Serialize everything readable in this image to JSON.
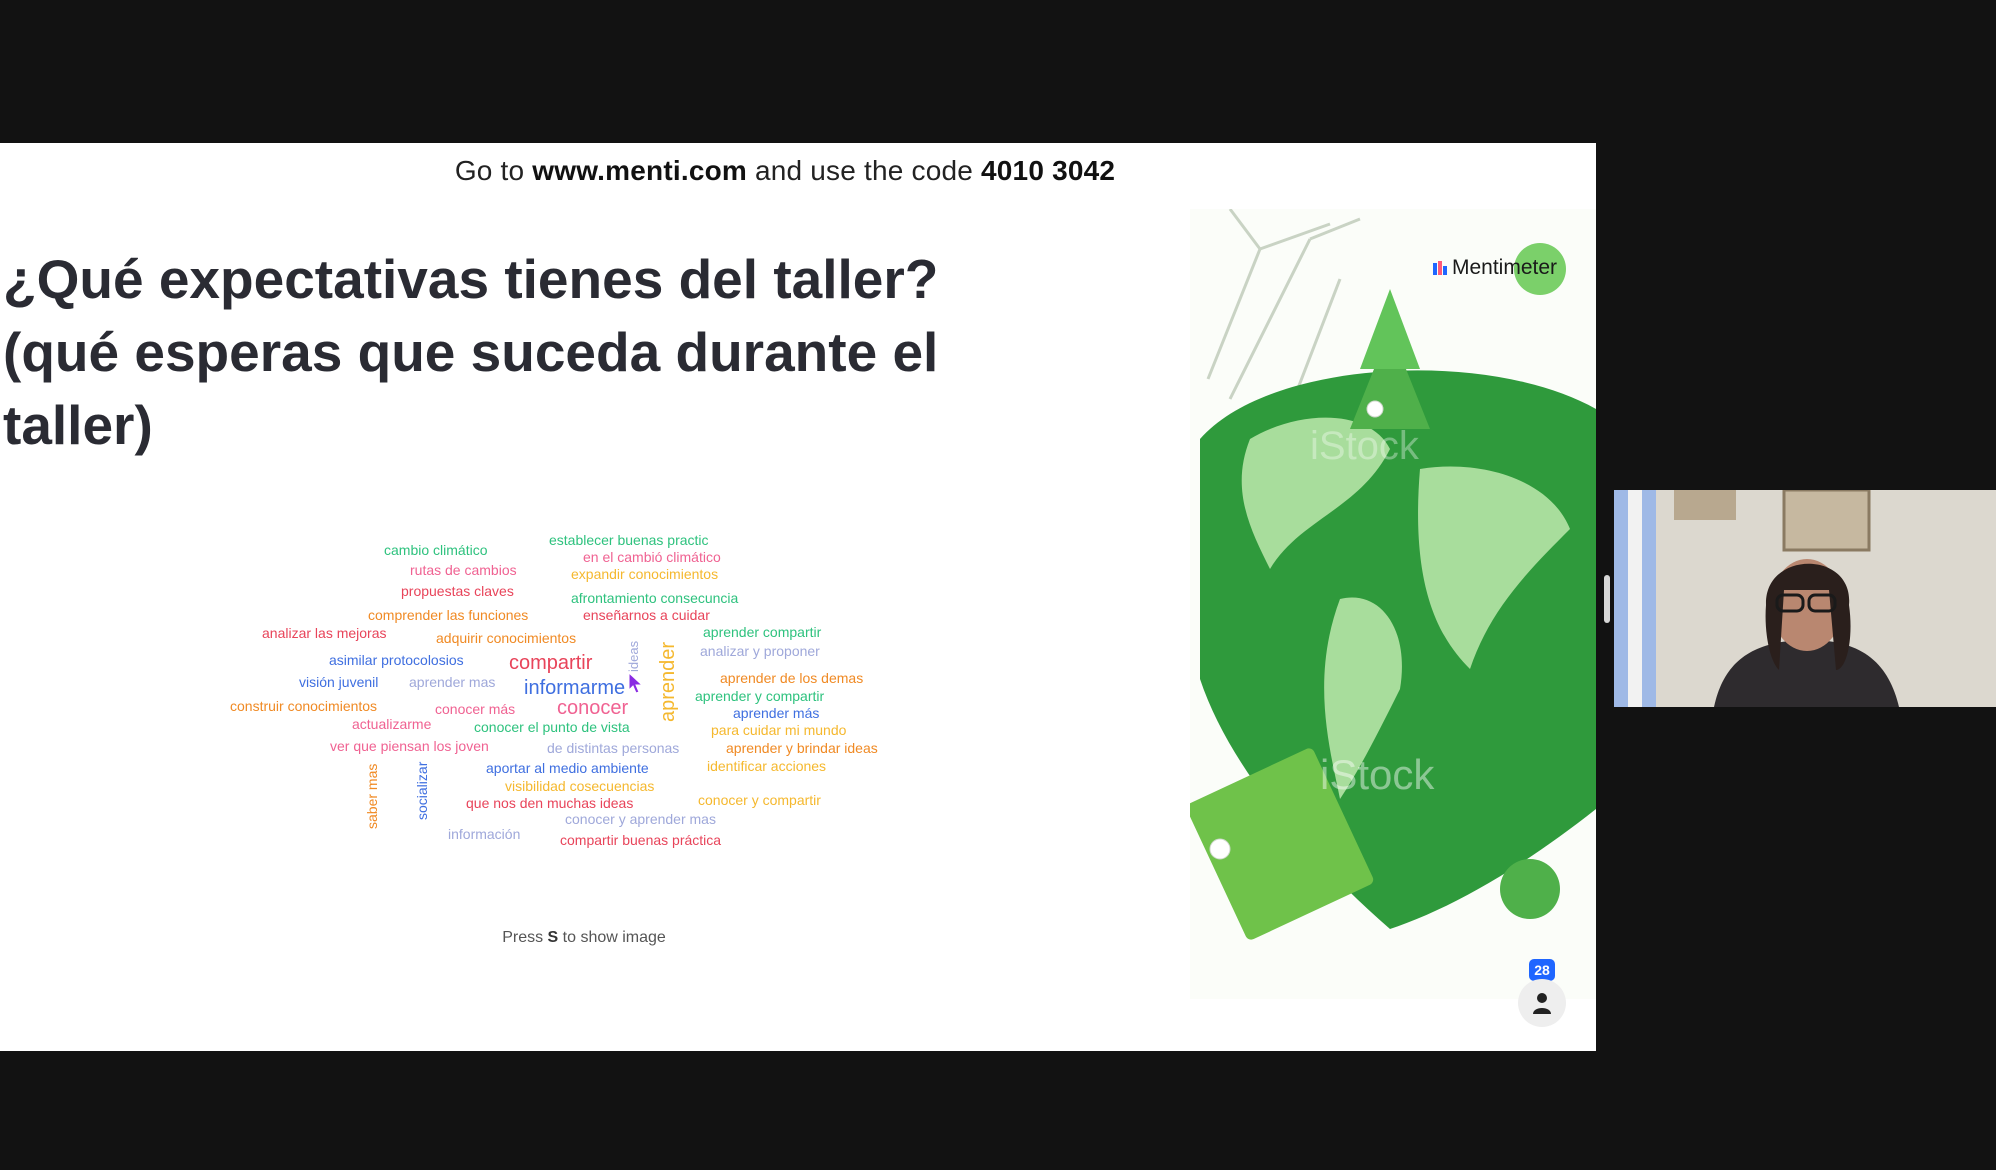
{
  "banner": {
    "prefix": "Go to ",
    "url": "www.menti.com",
    "middle": " and use the code ",
    "code": "4010 3042"
  },
  "question": {
    "line1": "¿Qué expectativas tienes del taller?",
    "line2": "(qué esperas que suceda durante el",
    "line3": "taller)"
  },
  "word_cloud": [
    {
      "text": "establecer buenas practic",
      "color": "#2ec27e"
    },
    {
      "text": "cambio climático",
      "color": "#2ec27e"
    },
    {
      "text": "en el cambió climático",
      "color": "#f06292"
    },
    {
      "text": "rutas de cambios",
      "color": "#f06292"
    },
    {
      "text": "expandir conocimientos",
      "color": "#f5b82e"
    },
    {
      "text": "propuestas claves",
      "color": "#e8445a"
    },
    {
      "text": "afrontamiento consecuncia",
      "color": "#2ec27e"
    },
    {
      "text": "comprender las funciones",
      "color": "#f08a24"
    },
    {
      "text": "enseñarnos a cuidar",
      "color": "#e8445a"
    },
    {
      "text": "analizar las mejoras",
      "color": "#e8445a"
    },
    {
      "text": "adquirir conocimientos",
      "color": "#f08a24"
    },
    {
      "text": "aprender compartir",
      "color": "#2ec27e"
    },
    {
      "text": "analizar y proponer",
      "color": "#9fa8da"
    },
    {
      "text": "asimilar protocolosios",
      "color": "#3f6fe0"
    },
    {
      "text": "compartir",
      "color": "#e8445a"
    },
    {
      "text": "ideas",
      "color": "#9fa8da"
    },
    {
      "text": "aprender",
      "color": "#f5b82e"
    },
    {
      "text": "aprender de los demas",
      "color": "#f08a24"
    },
    {
      "text": "visión juvenil",
      "color": "#3f6fe0"
    },
    {
      "text": "aprender mas",
      "color": "#9fa8da"
    },
    {
      "text": "informarme",
      "color": "#3f6fe0"
    },
    {
      "text": "aprender y compartir",
      "color": "#2ec27e"
    },
    {
      "text": "construir conocimientos",
      "color": "#f08a24"
    },
    {
      "text": "conocer más",
      "color": "#f06292"
    },
    {
      "text": "conocer",
      "color": "#f06292"
    },
    {
      "text": "aprender más",
      "color": "#3f6fe0"
    },
    {
      "text": "actualizarme",
      "color": "#f06292"
    },
    {
      "text": "conocer el punto de vista",
      "color": "#2ec27e"
    },
    {
      "text": "para cuidar mi mundo",
      "color": "#f5b82e"
    },
    {
      "text": "ver que piensan los joven",
      "color": "#f06292"
    },
    {
      "text": "de distintas personas",
      "color": "#9fa8da"
    },
    {
      "text": "aprender y brindar ideas",
      "color": "#f08a24"
    },
    {
      "text": "identificar acciones",
      "color": "#f5b82e"
    },
    {
      "text": "aportar al medio ambiente",
      "color": "#3f6fe0"
    },
    {
      "text": "saber mas",
      "color": "#f08a24"
    },
    {
      "text": "socializar",
      "color": "#3f6fe0"
    },
    {
      "text": "visibilidad cosecuencias",
      "color": "#f5b82e"
    },
    {
      "text": "que nos den muchas ideas",
      "color": "#e8445a"
    },
    {
      "text": "conocer y compartir",
      "color": "#f5b82e"
    },
    {
      "text": "conocer y aprender mas",
      "color": "#9fa8da"
    },
    {
      "text": "información",
      "color": "#9fa8da"
    },
    {
      "text": "compartir buenas práctica",
      "color": "#e8445a"
    }
  ],
  "hint": {
    "prefix": "Press ",
    "key": "S",
    "suffix": " to show image"
  },
  "image_panel": {
    "brand": "Mentimeter",
    "watermark": "iStock"
  },
  "audience": {
    "count": "28",
    "icon": "person-icon"
  },
  "colors": {
    "brand_blue": "#1f66ff",
    "globe_green": "#2f9a3c"
  }
}
